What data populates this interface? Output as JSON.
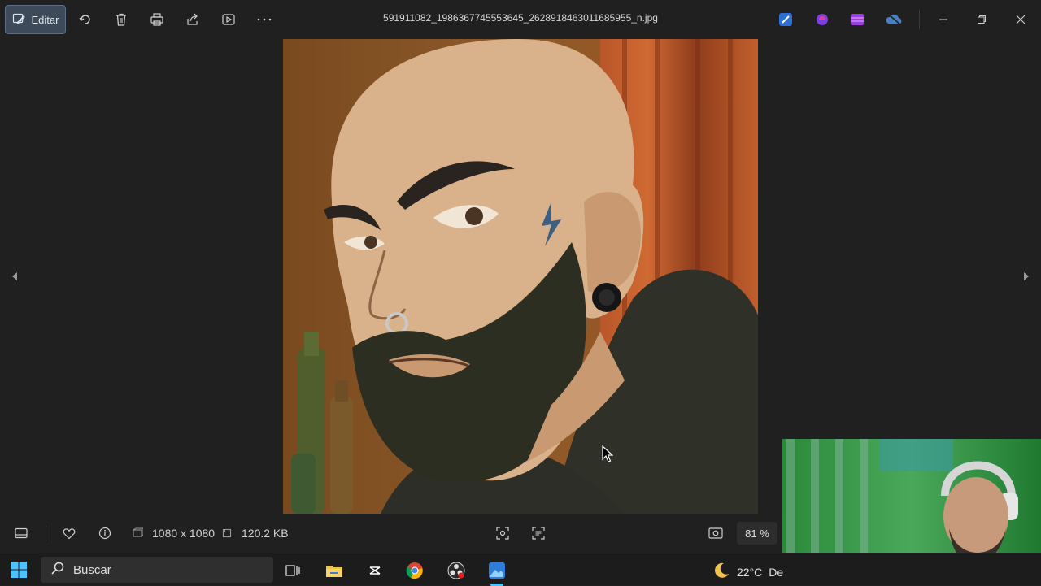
{
  "titlebar": {
    "edit_label": "Editar",
    "file_name": "591911082_1986367745553645_2628918463011685955_n.jpg"
  },
  "image": {
    "description_icon": "portrait-illustration"
  },
  "statusbar": {
    "dimensions": "1080 x 1080",
    "file_size": "120.2 KB",
    "zoom": "81 %"
  },
  "taskbar": {
    "search_label": "Buscar",
    "temperature": "22°C",
    "weather_text": "De"
  },
  "colors": {
    "accent": "#3d4a5a",
    "background": "#202020",
    "taskbar": "#1c1c1c"
  }
}
